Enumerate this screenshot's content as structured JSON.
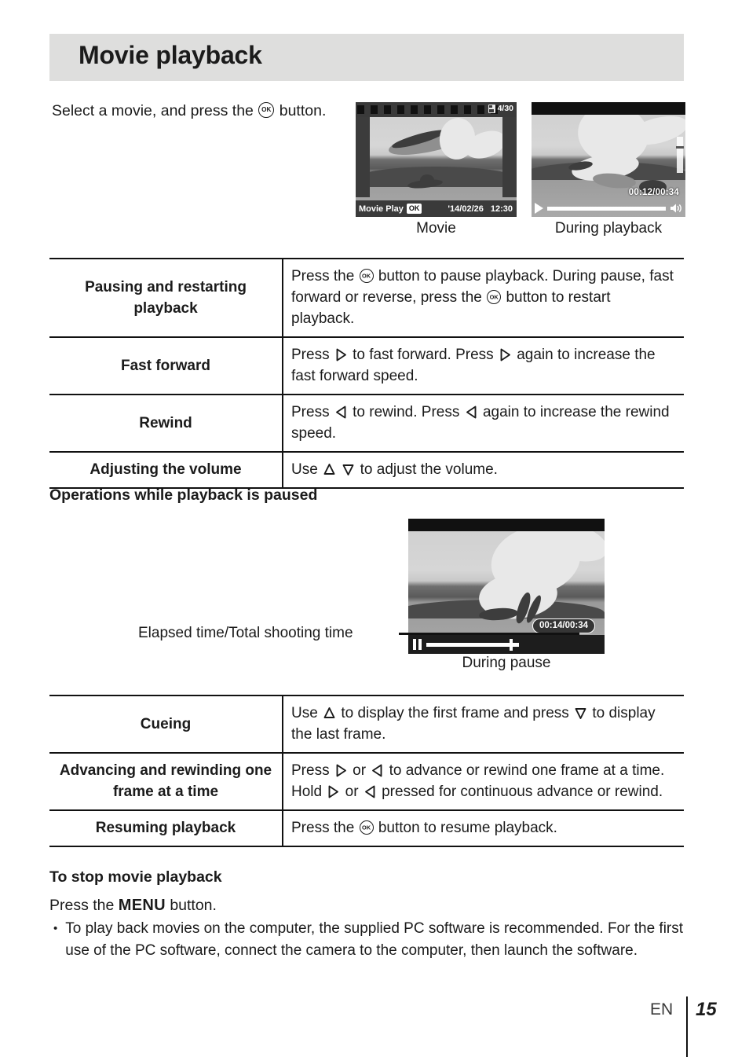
{
  "page": {
    "title": "Movie playback",
    "language_code": "EN",
    "page_number": "15"
  },
  "intro": {
    "text_before": "Select a movie, and press the",
    "text_after": "button.",
    "ok_icon": "ok-button-icon"
  },
  "figures": {
    "movie": {
      "caption": "Movie",
      "frame_count": "4/30",
      "card_icon": "memory-card-icon",
      "mode_label": "Movie Play",
      "ok_badge": "OK",
      "date": "'14/02/26",
      "time": "12:30"
    },
    "during_playback": {
      "caption": "During playback",
      "timecode": "00:12/00:34",
      "play_icon": "play-icon",
      "speaker_icon": "speaker-icon"
    },
    "during_pause": {
      "caption": "During pause",
      "timecode": "00:14/00:34",
      "pause_icon": "pause-icon",
      "callout_label": "Elapsed time/Total shooting time"
    }
  },
  "table_playback": {
    "rows": [
      {
        "label": "Pausing and restarting playback",
        "desc_parts": [
          "Press the",
          "button to pause playback. During pause, fast forward or reverse, press the",
          "button to restart playback."
        ]
      },
      {
        "label": "Fast forward",
        "desc_parts": [
          "Press",
          "to fast forward. Press",
          "again to increase the fast forward speed."
        ]
      },
      {
        "label": "Rewind",
        "desc_parts": [
          "Press",
          "to rewind. Press",
          "again to increase the rewind speed."
        ]
      },
      {
        "label": "Adjusting the volume",
        "desc_parts": [
          "Use",
          "to adjust the volume."
        ]
      }
    ]
  },
  "section_paused": {
    "heading": "Operations while playback is paused"
  },
  "table_paused": {
    "rows": [
      {
        "label": "Cueing",
        "desc_parts": [
          "Use",
          "to display the first frame and press",
          "to display the last frame."
        ]
      },
      {
        "label": "Advancing and rewinding one frame at a time",
        "desc_parts": [
          "Press",
          "or",
          "to advance or rewind one frame at a time. Hold",
          "or",
          "pressed for continuous advance or rewind."
        ]
      },
      {
        "label": "Resuming playback",
        "desc_parts": [
          "Press the",
          "button to resume playback."
        ]
      }
    ]
  },
  "section_stop": {
    "heading": "To stop movie playback",
    "instruction_before": "Press the",
    "menu_label": "MENU",
    "instruction_after": "button.",
    "bullet_marker": "•",
    "bullet_text": "To play back movies on the computer, the supplied PC software is recommended. For the first use of the PC software, connect the camera to the computer, then launch the software."
  },
  "colors": {
    "header_band": "#dededd",
    "ink": "#1b1b1b",
    "rule": "#111111"
  }
}
